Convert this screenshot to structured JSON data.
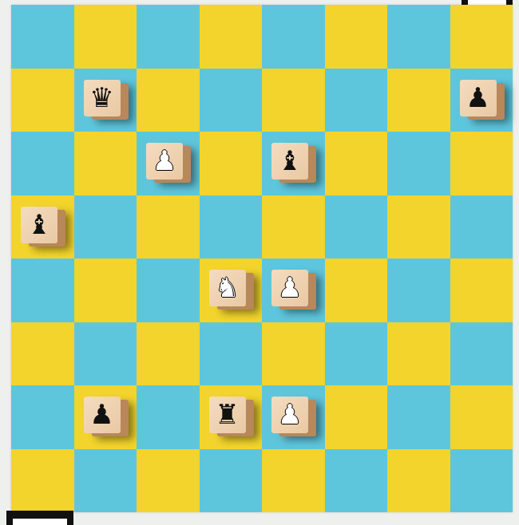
{
  "board": {
    "light_color": "#f2d42c",
    "dark_color": "#5ec6dc",
    "top_left_color": "dark",
    "pieces": [
      {
        "square": "b7",
        "color": "black",
        "type": "queen"
      },
      {
        "square": "h7",
        "color": "black",
        "type": "pawn"
      },
      {
        "square": "c6",
        "color": "white",
        "type": "pawn"
      },
      {
        "square": "e6",
        "color": "black",
        "type": "bishop"
      },
      {
        "square": "a5",
        "color": "black",
        "type": "bishop"
      },
      {
        "square": "d4",
        "color": "white",
        "type": "knight"
      },
      {
        "square": "e4",
        "color": "white",
        "type": "pawn"
      },
      {
        "square": "b2",
        "color": "black",
        "type": "pawn"
      },
      {
        "square": "d2",
        "color": "black",
        "type": "rook"
      },
      {
        "square": "e2",
        "color": "white",
        "type": "pawn"
      }
    ]
  }
}
